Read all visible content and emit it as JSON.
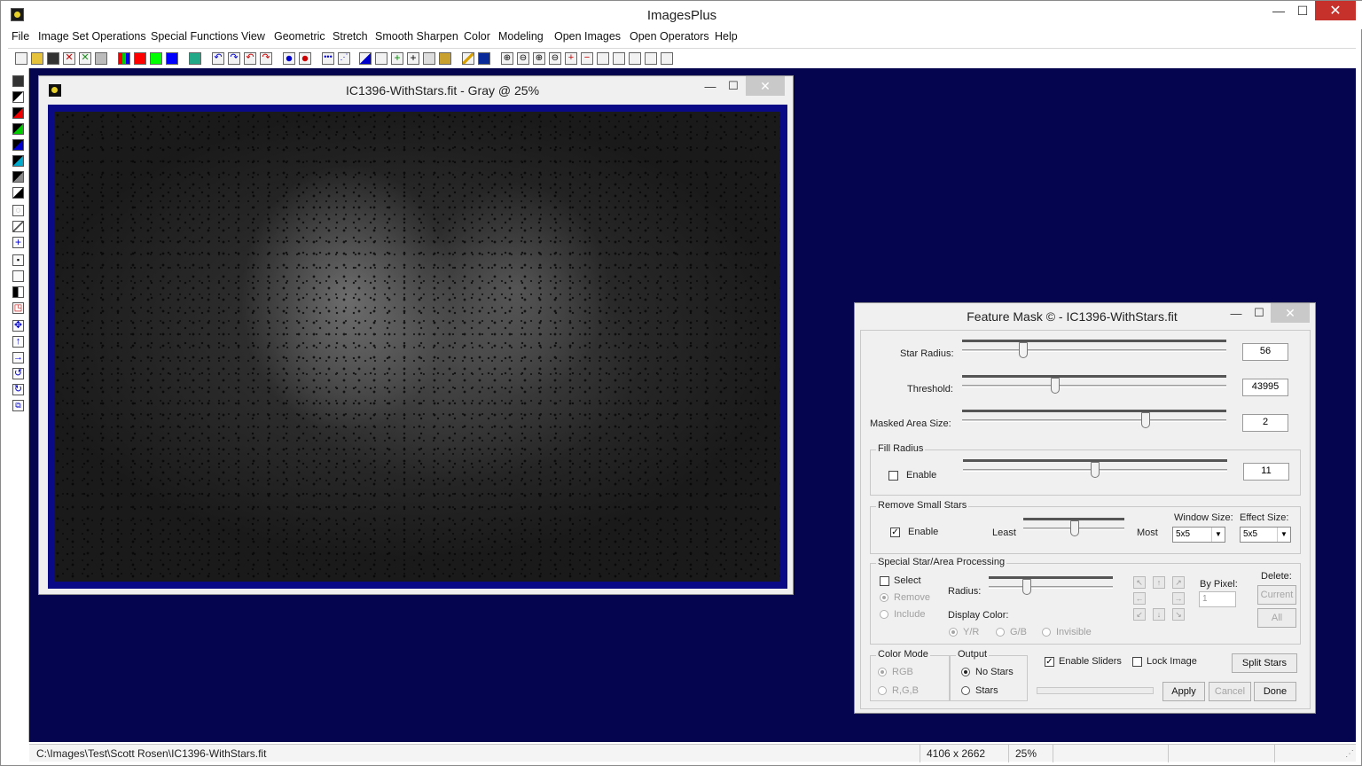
{
  "app": {
    "title": "ImagesPlus",
    "min": "—",
    "max": "☐",
    "close": "✕"
  },
  "menu": [
    "File",
    "Image Set Operations",
    "Special Functions",
    "View",
    "Geometric",
    "Stretch",
    "Smooth Sharpen",
    "Color",
    "Modeling",
    "Open Images",
    "Open Operators",
    "Help"
  ],
  "image_window": {
    "title": "IC1396-WithStars.fit - Gray @ 25%",
    "min": "—",
    "max": "☐",
    "close": "✕"
  },
  "feature_mask": {
    "title": "Feature Mask © - IC1396-WithStars.fit",
    "min": "—",
    "max": "☐",
    "close": "✕",
    "star_radius": {
      "label": "Star Radius:",
      "value": "56"
    },
    "threshold": {
      "label": "Threshold:",
      "value": "43995"
    },
    "masked_area": {
      "label": "Masked Area Size:",
      "value": "2"
    },
    "fill_radius": {
      "group": "Fill Radius",
      "enable_label": "Enable",
      "value": "11"
    },
    "remove_small": {
      "group": "Remove Small Stars",
      "enable_label": "Enable",
      "least": "Least",
      "most": "Most",
      "window_size_label": "Window Size:",
      "window_size": "5x5",
      "effect_size_label": "Effect Size:",
      "effect_size": "5x5"
    },
    "special": {
      "group": "Special Star/Area Processing",
      "select": "Select",
      "remove": "Remove",
      "include": "Include",
      "radius": "Radius:",
      "display_color": "Display Color:",
      "yr": "Y/R",
      "gb": "G/B",
      "invisible": "Invisible",
      "by_pixel": "By Pixel:",
      "by_pixel_value": "1",
      "delete": "Delete:",
      "current": "Current",
      "all": "All"
    },
    "color_mode": {
      "group": "Color Mode",
      "rgb": "RGB",
      "rgb2": "R,G,B"
    },
    "output": {
      "group": "Output",
      "no_stars": "No Stars",
      "stars": "Stars"
    },
    "enable_sliders": "Enable Sliders",
    "lock_image": "Lock Image",
    "split_stars": "Split Stars",
    "apply": "Apply",
    "cancel": "Cancel",
    "done": "Done"
  },
  "status": {
    "path": "C:\\Images\\Test\\Scott Rosen\\IC1396-WithStars.fit",
    "dims": "4106 x 2662",
    "zoom": "25%"
  },
  "colors": {
    "workspace": "#04044f",
    "image_frame": "#0a0a86",
    "close_red": "#c7312c"
  }
}
